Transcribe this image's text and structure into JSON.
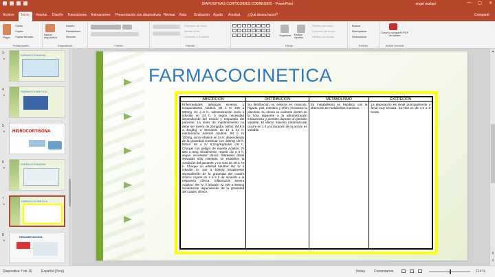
{
  "window": {
    "title": "DIAPOSITIVAS CORTICOIDES CORREGIDO - PowerPoint",
    "user": "angel mallqui",
    "controls": [
      "—",
      "▢",
      "✕"
    ]
  },
  "tabs": [
    "Archivo",
    "Inicio",
    "Insertar",
    "Diseño",
    "Transiciones",
    "Animaciones",
    "Presentación con diapositivas",
    "Revisar",
    "Vista",
    "Grabación",
    "Ayuda",
    "Acrobat",
    "¿Qué desea hacer?"
  ],
  "active_tab": "Inicio",
  "share_label": "Compartir",
  "ribbon": {
    "portapapeles": {
      "label": "Portapapeles",
      "pegar": "Pegar",
      "cortar": "Cortar",
      "copiar": "Copiar",
      "copiar_formato": "Copiar formato"
    },
    "diapositivas": {
      "label": "Diapositivas",
      "nueva": "Nueva diapositiva",
      "diseno": "Diseño",
      "restablecer": "Restablecer",
      "seccion": "Sección"
    },
    "fuente": {
      "label": "Fuente"
    },
    "parrafo": {
      "label": "Párrafo",
      "direccion": "Dirección del texto",
      "alinear": "Alinear texto",
      "smartart": "Convertir a SmartArt"
    },
    "dibujo": {
      "label": "Dibujo",
      "organizar": "Organizar",
      "estilos": "Estilos rápidos",
      "relleno": "Relleno de forma",
      "contorno": "Contorno de forma",
      "efectos": "Efectos de formas"
    },
    "edicion": {
      "label": "Edición",
      "buscar": "Buscar",
      "reemplazar": "Reemplazar",
      "seleccionar": "Seleccionar"
    },
    "adobe": {
      "label": "Adobe Acrobat",
      "crear": "Crear y compartir PDF de Adobe"
    }
  },
  "thumbnails": [
    {
      "num": "3",
      "title": "FARMACODINAMIA"
    },
    {
      "num": "4",
      "title": "FARMACOCINETICA"
    },
    {
      "num": "5",
      "title": "HIDROCORTISONA"
    },
    {
      "num": "6",
      "title": "FARMACODINAMIA"
    },
    {
      "num": "7",
      "title": "FARMACOCINETICA"
    },
    {
      "num": "8",
      "title": "DEXAMETASONA"
    }
  ],
  "selected_thumbnail": "7",
  "slide": {
    "title": "FARMACOCINETICA",
    "table": {
      "headers": [
        "ABSORCION",
        "DISTRIBUCION",
        "METABOLISMO",
        "EXCRECION"
      ],
      "cells": [
        "Enfermedades alérgicas severas o incapacitantes Adultos: IM ó IV 100 a 500mg c/2 a 8 h., administración lenta ó infusión en 24 h, ó según necesidad dependiendo del estado y respuesta del paciente. La dosis de mantenimiento no debe ser menor de 25mg/día. Niños: IM 8,5 a 4mg/kg, a intervalos de 12 a 24 h. Insuficiencia adrenal Adultos: IM ó IV 100mg, inicio infusión en 24 h, dependiendo de la gravedad continuar con 100mg c/8 h. Niños: IM ó IV 8,2mg/Kg/dosis c/8 h. Choque con peligro de muerte Adultos: IV 500 a 2mg inicialmente, repetir c/2 a 6 h, según necesidad clínica. Mantener dosis elevadas sólo mientras se estabilice la condición del paciente y no más de 48 a 72 h. Choque no adrenal Adultos: IM, IV ó infusión IV 100 a 500mg inicialmente dependiendo de la gravedad del cuadro clínico, repetir en 2 a 6 h de acuerdo a la respuesta clínica. Inflamación severa Adultos: IM, IV ó infusión IV 100 a 500mg inicialmente dependiendo de la gravedad del cuadro clínico.",
        "Su distribución es externa en músculo, hígado, piel, intestino y riñón. Atraviesa la placenta. Su efecto es evidente dentro de la hora siguiente a la administración intravenosa y persiste durante un periodo variable. El efecto máximo intramuscular ocurre en 1 h y la duración de la acción es variable",
        "Su metabolismo es hepático con la obtención de metabolitos inactivos.",
        "La depuración es renal principalmente y fecal muy escasa. Su t1/2 es de 1,5 a 2 horas."
      ]
    }
  },
  "status": {
    "slide_info": "Diapositiva 7 de 16",
    "language": "Español (Perú)",
    "notes": "Notas",
    "comments": "Comentarios",
    "zoom": "114 %"
  }
}
